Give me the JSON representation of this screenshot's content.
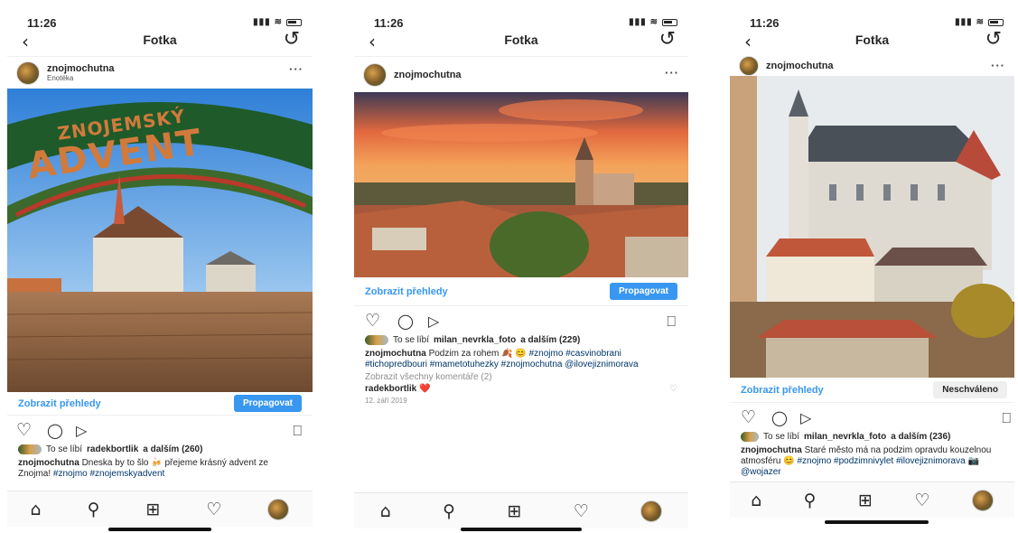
{
  "screens": [
    {
      "time": "11:26",
      "nav_title": "Fotka",
      "username": "znojmochutna",
      "location": "Enotéka",
      "photo_sign_line1": "ZNOJEMSKÝ",
      "photo_sign_line2": "ADVENT",
      "insights_label": "Zobrazit přehledy",
      "promote_label": "Propagovat",
      "likes_prefix": "To se líbí",
      "likes_user": "radekbortlik",
      "likes_suffix": "a dalším (260)",
      "caption_user": "znojmochutna",
      "caption_text": "Dneska by to šlo 🍻 přejeme krásný advent ze Znojma!",
      "caption_tags": "#znojmo #znojemskyadvent"
    },
    {
      "time": "11:26",
      "nav_title": "Fotka",
      "username": "znojmochutna",
      "insights_label": "Zobrazit přehledy",
      "promote_label": "Propagovat",
      "likes_prefix": "To se líbí",
      "likes_user": "milan_nevrkla_foto",
      "likes_suffix": "a dalším (229)",
      "caption_user": "znojmochutna",
      "caption_text": "Podzim za rohem 🍂 😊",
      "caption_tags": "#znojmo #casvinobrani #tichopredbouri #mametotuhezky #znojmochutna @ilovejiznimorava",
      "view_comments": "Zobrazit všechny komentáře (2)",
      "comment_user": "radekbortlik",
      "comment_text": "❤️",
      "date": "12. září 2019"
    },
    {
      "time": "11:26",
      "nav_title": "Fotka",
      "username": "znojmochutna",
      "insights_label": "Zobrazit přehledy",
      "status_label": "Neschváleno",
      "likes_prefix": "To se líbí",
      "likes_user": "milan_nevrkla_foto",
      "likes_suffix": "a dalším (236)",
      "caption_user": "znojmochutna",
      "caption_text": "Staré město má na podzim opravdu kouzelnou atmosféru 😊",
      "caption_tags": "#znojmo #podzimnivylet #ilovejiznimorava 📷 @wojazer"
    }
  ],
  "icons": {
    "back": "‹",
    "refresh": "↺",
    "more": "···",
    "heart": "♡",
    "comment": "◯",
    "share": "▷",
    "save": "⎕",
    "home": "⌂",
    "search": "⚲",
    "add": "⊞"
  },
  "colors": {
    "link_blue": "#3897f0",
    "tag_blue": "#003569",
    "like_red": "#ed4956"
  }
}
